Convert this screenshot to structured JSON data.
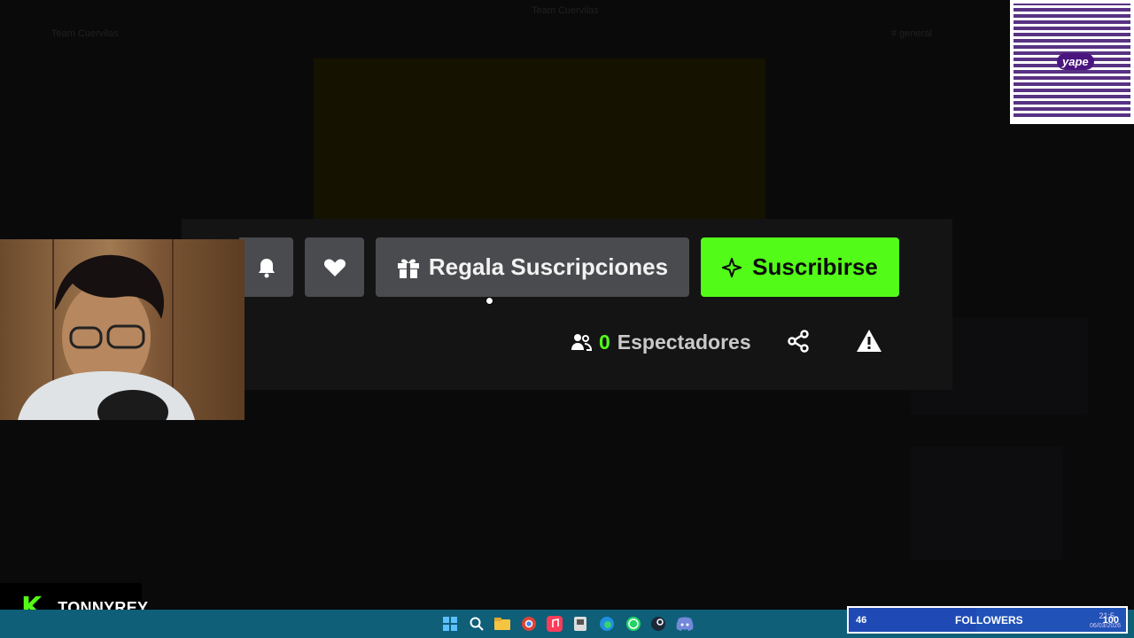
{
  "background": {
    "server_name": "Team Cuervilas",
    "channel_name": "Team Cuervilas",
    "chat_header": "# general"
  },
  "actions": {
    "gift_label": "Regala Suscripciones",
    "subscribe_label": "Suscribirse"
  },
  "viewers": {
    "count": "0",
    "label": "Espectadores"
  },
  "qr": {
    "label": "yape"
  },
  "brand": {
    "logo_letter": "K",
    "channel_name": "TONNYREY"
  },
  "followers_goal": {
    "current": "46",
    "label": "FOLLOWERS",
    "target": "100",
    "progress": 0.46
  },
  "clock": {
    "time": "21:5",
    "date": "06/03/2026"
  },
  "colors": {
    "kick_green": "#53fc18",
    "button_gray": "#4a4b4e",
    "taskbar": "#0f5f78",
    "followers_bar": "#2052b8"
  }
}
